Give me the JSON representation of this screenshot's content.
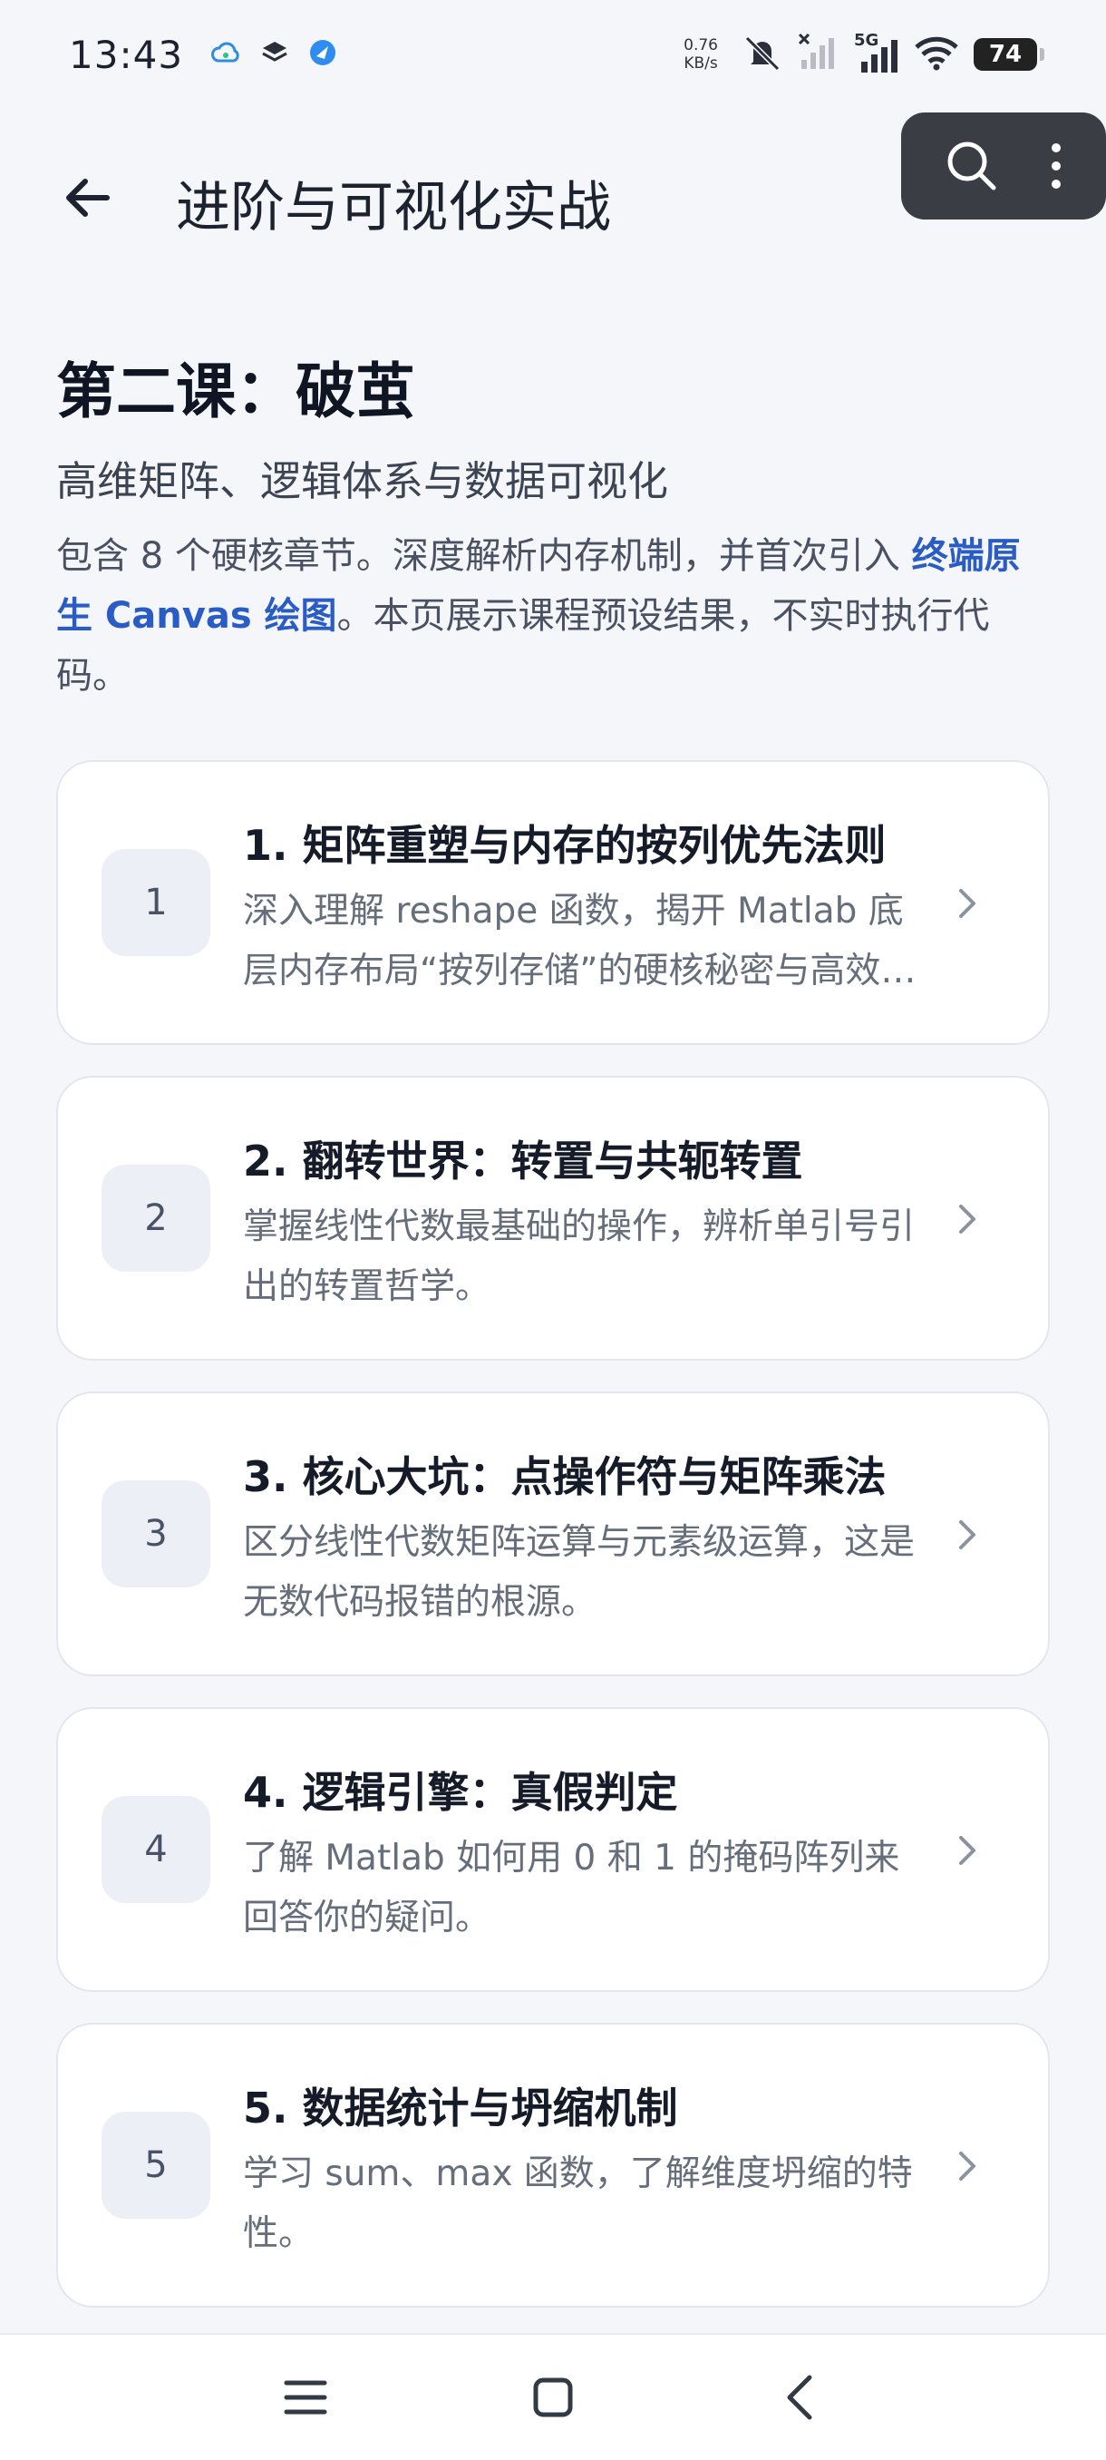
{
  "status_bar": {
    "time": "13:43",
    "net_speed_value": "0.76",
    "net_speed_unit": "KB/s",
    "network_type": "5G",
    "battery_level": "74"
  },
  "header": {
    "title": "进阶与可视化实战"
  },
  "lesson": {
    "title": "第二课：破茧",
    "subtitle": "高维矩阵、逻辑体系与数据可视化",
    "desc_part1": "包含 8 个硬核章节。深度解析内存机制，并首次引入 ",
    "desc_highlight": "终端原生 Canvas 绘图",
    "desc_part2": "。本页展示课程预设结果，不实时执行代码。"
  },
  "chapters": [
    {
      "number": "1",
      "title": "1. 矩阵重塑与内存的按列优先法则",
      "desc": "深入理解 reshape 函数，揭开 Matlab 底层内存布局“按列存储”的硬核秘密与高效访问技巧。"
    },
    {
      "number": "2",
      "title": "2. 翻转世界：转置与共轭转置",
      "desc": "掌握线性代数最基础的操作，辨析单引号引出的转置哲学。"
    },
    {
      "number": "3",
      "title": "3. 核心大坑：点操作符与矩阵乘法",
      "desc": "区分线性代数矩阵运算与元素级运算，这是无数代码报错的根源。"
    },
    {
      "number": "4",
      "title": "4. 逻辑引擎：真假判定",
      "desc": "了解 Matlab 如何用 0 和 1 的掩码阵列来回答你的疑问。"
    },
    {
      "number": "5",
      "title": "5. 数据统计与坍缩机制",
      "desc": "学习 sum、max 函数，了解维度坍缩的特性。"
    }
  ],
  "colors": {
    "accent": "#2a5cc6",
    "background": "#f5f6fa",
    "card": "#ffffff",
    "badge": "#eceff6"
  }
}
